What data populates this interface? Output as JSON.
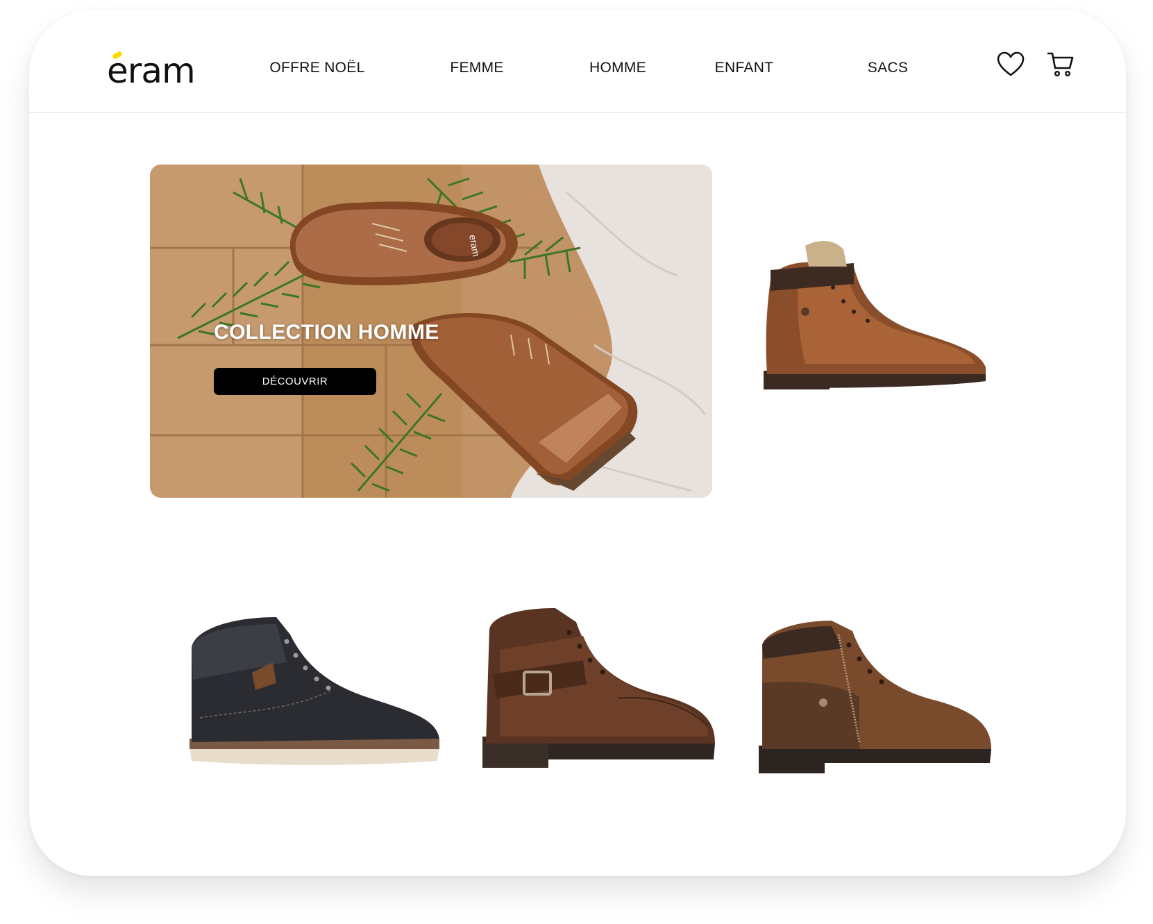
{
  "brand": {
    "name": "eram",
    "accent_color": "#ffd800"
  },
  "nav": {
    "items": [
      {
        "label": "OFFRE NOËL"
      },
      {
        "label": "FEMME"
      },
      {
        "label": "HOMME"
      },
      {
        "label": "ENFANT"
      },
      {
        "label": "SACS"
      }
    ]
  },
  "header_icons": {
    "wishlist": "heart-icon",
    "cart": "cart-icon"
  },
  "hero": {
    "title": "COLLECTION HOMME",
    "button_label": "DÉCOUVRIR",
    "shoe_brand": "eram"
  },
  "products": [
    {
      "name": "brown-leather-ankle-boot",
      "color": "#8a4e2a"
    },
    {
      "name": "black-sneaker-boot",
      "color": "#2a2c31"
    },
    {
      "name": "brown-buckle-boot",
      "color": "#5a3422"
    },
    {
      "name": "brown-zip-boot",
      "color": "#7a4a2c"
    }
  ]
}
